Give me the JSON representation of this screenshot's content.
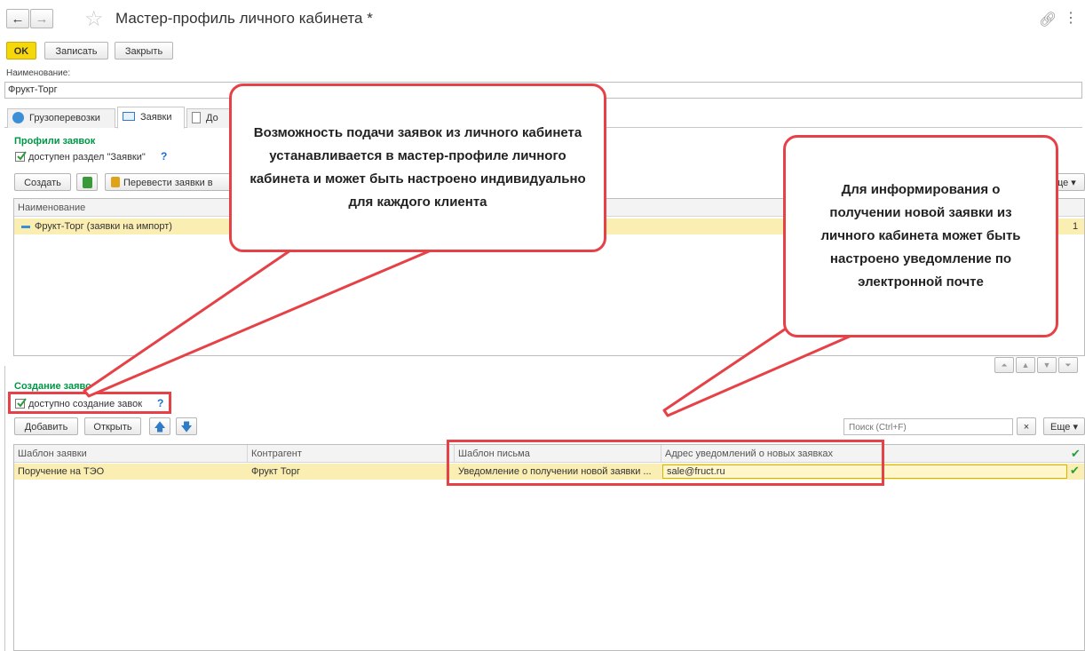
{
  "window": {
    "title": "Мастер-профиль личного кабинета *"
  },
  "toolbar": {
    "ok": "OK",
    "save": "Записать",
    "close": "Закрыть"
  },
  "name_field": {
    "label": "Наименование:",
    "value": "Фрукт-Торг"
  },
  "tabs": [
    {
      "label": "Грузоперевозки"
    },
    {
      "label": "Заявки"
    },
    {
      "label": "До"
    }
  ],
  "profiles": {
    "title": "Профили заявок",
    "checkbox_label": "доступен раздел \"Заявки\"",
    "help": "?",
    "create": "Создать",
    "transfer": "Перевести заявки в",
    "more": "ще",
    "column": "Наименование",
    "rows": [
      {
        "name": "Фрукт-Торг (заявки на импорт)",
        "tail": "1"
      }
    ]
  },
  "creation": {
    "title": "Создание заявок",
    "checkbox_label": "доступно создание завок",
    "help": "?",
    "add": "Добавить",
    "open": "Открыть",
    "search_placeholder": "Поиск (Ctrl+F)",
    "clear": "×",
    "more": "Еще",
    "columns": [
      "Шаблон заявки",
      "Контрагент",
      "Шаблон письма",
      "Адрес уведомлений о новых заявках"
    ],
    "rows": [
      {
        "template": "Поручение на ТЭО",
        "counterparty": "Фрукт Торг",
        "letter": "Уведомление о получении новой заявки ...",
        "email": "sale@fruct.ru"
      }
    ]
  },
  "callouts": {
    "left": "Возможность подачи заявок из личного кабинета устанавливается в мастер-профиле личного кабинета и может быть настроено индивидуально для каждого клиента",
    "right": "Для информирования о получении новой заявки из личного кабинета может быть настроено уведомление по электронной почте"
  },
  "colors": {
    "accent": "#f6d80a",
    "section": "#009646",
    "callout_border": "#e64147",
    "selection": "#fbeeb3"
  }
}
